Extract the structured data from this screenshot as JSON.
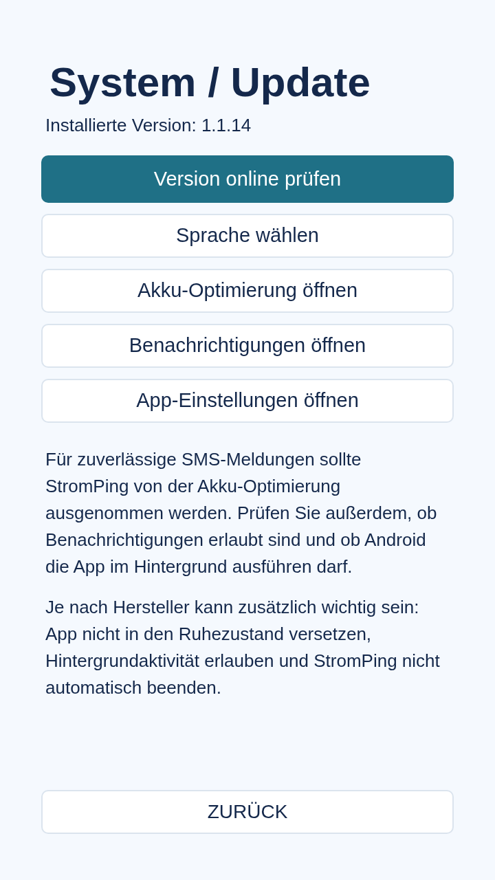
{
  "title": "System / Update",
  "installed_version": "Installierte Version: 1.1.14",
  "buttons": [
    {
      "label": "Version online prüfen",
      "kind": "primary"
    },
    {
      "label": "Sprache wählen",
      "kind": "secondary"
    },
    {
      "label": "Akku-Optimierung öffnen",
      "kind": "secondary"
    },
    {
      "label": "Benachrichtigungen öffnen",
      "kind": "secondary"
    },
    {
      "label": "App-Einstellungen öffnen",
      "kind": "secondary"
    }
  ],
  "paragraphs": [
    "Für zuverlässige SMS-Meldungen sollte StromPing von der Akku-Optimierung ausgenommen werden. Prüfen Sie außerdem, ob Benachrichtigungen erlaubt sind und ob Android die App im Hintergrund ausführen darf.",
    "Je nach Hersteller kann zusätzlich wichtig sein: App nicht in den Ruhezustand versetzen, Hintergrundaktivität erlauben und StromPing nicht automatisch beenden."
  ],
  "back_button": "ZURÜCK"
}
